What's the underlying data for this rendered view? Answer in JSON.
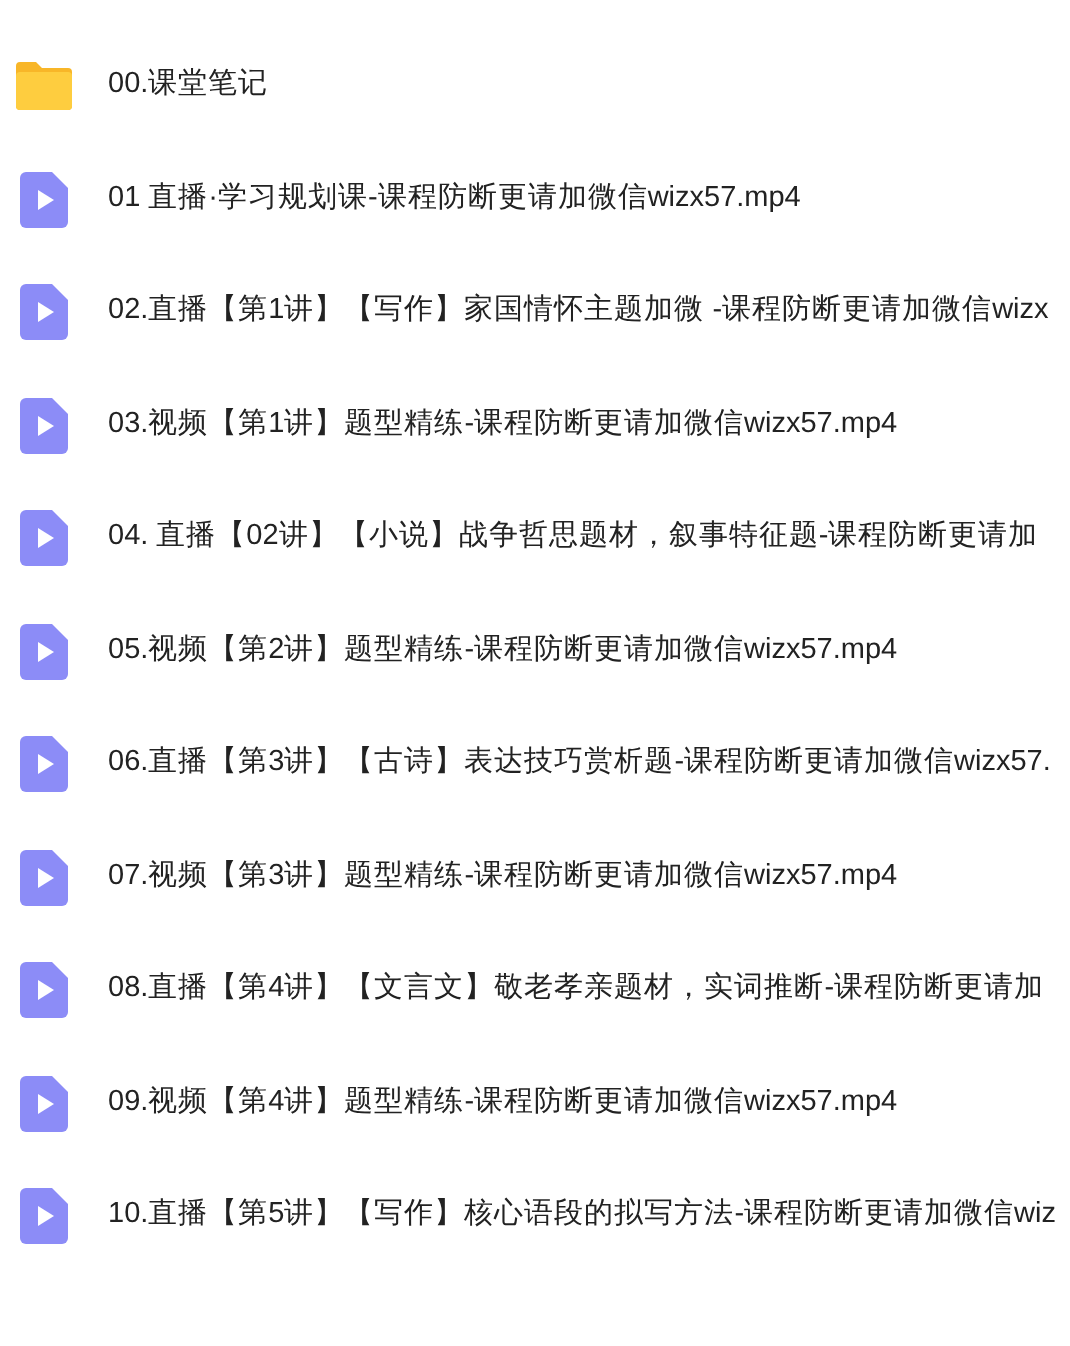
{
  "files": [
    {
      "kind": "folder",
      "name": "00.课堂笔记"
    },
    {
      "kind": "video",
      "name": "01 直播·学习规划课-课程防断更请加微信wizx57.mp4"
    },
    {
      "kind": "video",
      "name": "02.直播【第1讲】【写作】家国情怀主题加微 -课程防断更请加微信wizx"
    },
    {
      "kind": "video",
      "name": "03.视频【第1讲】题型精练-课程防断更请加微信wizx57.mp4"
    },
    {
      "kind": "video",
      "name": "04. 直播【02讲】【小说】战争哲思题材，叙事特征题-课程防断更请加"
    },
    {
      "kind": "video",
      "name": "05.视频【第2讲】题型精练-课程防断更请加微信wizx57.mp4"
    },
    {
      "kind": "video",
      "name": "06.直播【第3讲】【古诗】表达技巧赏析题-课程防断更请加微信wizx57."
    },
    {
      "kind": "video",
      "name": "07.视频【第3讲】题型精练-课程防断更请加微信wizx57.mp4"
    },
    {
      "kind": "video",
      "name": "08.直播【第4讲】【文言文】敬老孝亲题材，实词推断-课程防断更请加"
    },
    {
      "kind": "video",
      "name": "09.视频【第4讲】题型精练-课程防断更请加微信wizx57.mp4"
    },
    {
      "kind": "video",
      "name": "10.直播【第5讲】【写作】核心语段的拟写方法-课程防断更请加微信wiz"
    }
  ]
}
